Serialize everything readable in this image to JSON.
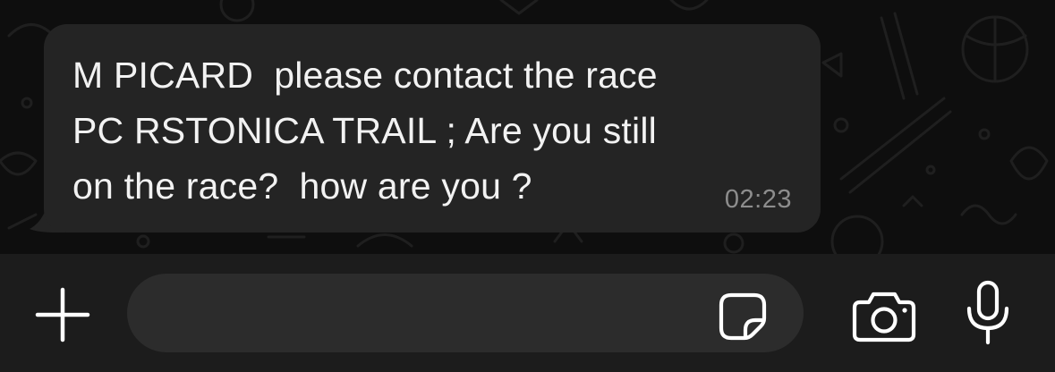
{
  "conversation": {
    "message": {
      "text": "M PICARD  please contact the race\nPC RSTONICA TRAIL ; Are you still\non the race?  how are you ?",
      "time": "02:23",
      "direction": "incoming"
    }
  },
  "composer": {
    "input_value": "",
    "placeholder": "",
    "attach_icon": "plus-icon",
    "sticker_icon": "sticker-icon",
    "camera_icon": "camera-icon",
    "mic_icon": "microphone-icon"
  },
  "colors": {
    "chat_background": "#0e0e0e",
    "bubble": "#242424",
    "message_text": "#f2f2f2",
    "timestamp": "#8d8d8d",
    "input_bar": "#1c1c1c",
    "input_field": "#2c2c2c",
    "icon": "#ffffff"
  }
}
